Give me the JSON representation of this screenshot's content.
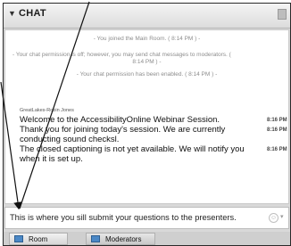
{
  "panel": {
    "title": "CHAT",
    "collapse_icon": "triangle-down-icon"
  },
  "messages": {
    "system_joined": "- You joined the Main Room. ( 8:14 PM ) -",
    "system_permission_off_1": "- Your chat permission is off; however, you may send chat messages to moderators. (",
    "system_permission_off_2": "8:14 PM ) -",
    "system_permission_enabled": "- Your chat permission has been enabled. ( 8:14 PM ) -",
    "sender": "GreatLakes-Robin Jones",
    "lines": [
      {
        "text": "Welcome to the AccessibilityOnline Webinar Session.",
        "time": "8:16 PM"
      },
      {
        "text": "Thank you for joining today's session. We are currently",
        "time": "8:16 PM"
      },
      {
        "text": "conducting sound checksl.",
        "time": ""
      },
      {
        "text": "The closed captioning is not yet available. We will notify you",
        "time": "8:16 PM"
      },
      {
        "text": "when it is set up.",
        "time": ""
      }
    ]
  },
  "input": {
    "value": "This is where you sill submit your questions to the presenters."
  },
  "tabs": [
    {
      "label": "Room"
    },
    {
      "label": "Moderators"
    }
  ],
  "icons": {
    "emoji": "smiley-icon",
    "room": "room-icon",
    "moderators": "moderators-icon"
  },
  "colors": {
    "arrow": "#111111",
    "link_blue": "#4b88c6"
  }
}
